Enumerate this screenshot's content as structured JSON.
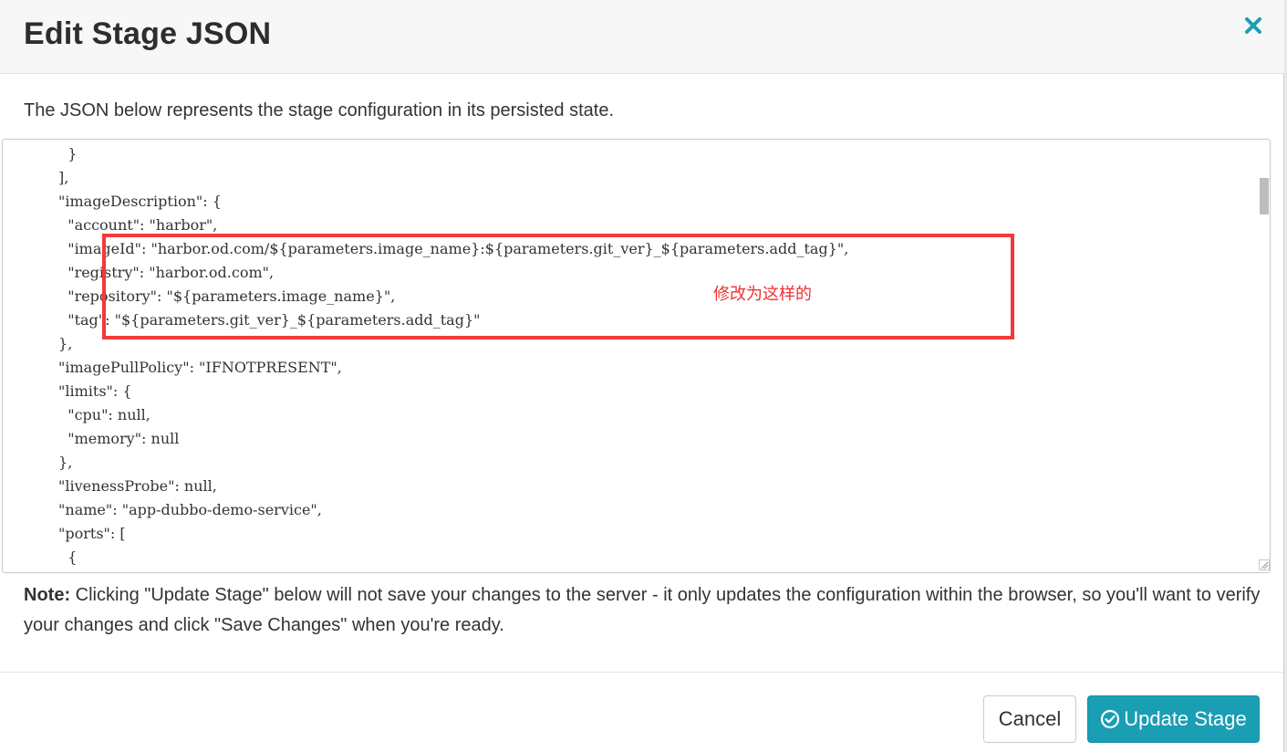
{
  "dialog": {
    "title": "Edit Stage JSON",
    "close_icon": "close-icon",
    "intro": "The JSON below represents the stage configuration in its persisted state."
  },
  "editor": {
    "lines": [
      "              }",
      "            ],",
      "            \"imageDescription\": {",
      "              \"account\": \"harbor\",",
      "              \"imageId\": \"harbor.od.com/${parameters.image_name}:${parameters.git_ver}_${parameters.add_tag}\",",
      "              \"registry\": \"harbor.od.com\",",
      "              \"repository\": \"${parameters.image_name}\",",
      "              \"tag\": \"${parameters.git_ver}_${parameters.add_tag}\"",
      "            },",
      "            \"imagePullPolicy\": \"IFNOTPRESENT\",",
      "            \"limits\": {",
      "              \"cpu\": null,",
      "              \"memory\": null",
      "            },",
      "            \"livenessProbe\": null,",
      "            \"name\": \"app-dubbo-demo-service\",",
      "            \"ports\": [",
      "              {"
    ],
    "annotation": "修改为这样的",
    "highlight_color": "#f23a3a"
  },
  "note": {
    "label": "Note:",
    "text": " Clicking \"Update Stage\" below will not save your changes to the server - it only updates the configuration within the browser, so you'll want to verify your changes and click \"Save Changes\" when you're ready."
  },
  "footer": {
    "cancel_label": "Cancel",
    "update_label": "Update Stage",
    "update_icon": "check-circle-icon",
    "accent_color": "#1a9eb4"
  }
}
